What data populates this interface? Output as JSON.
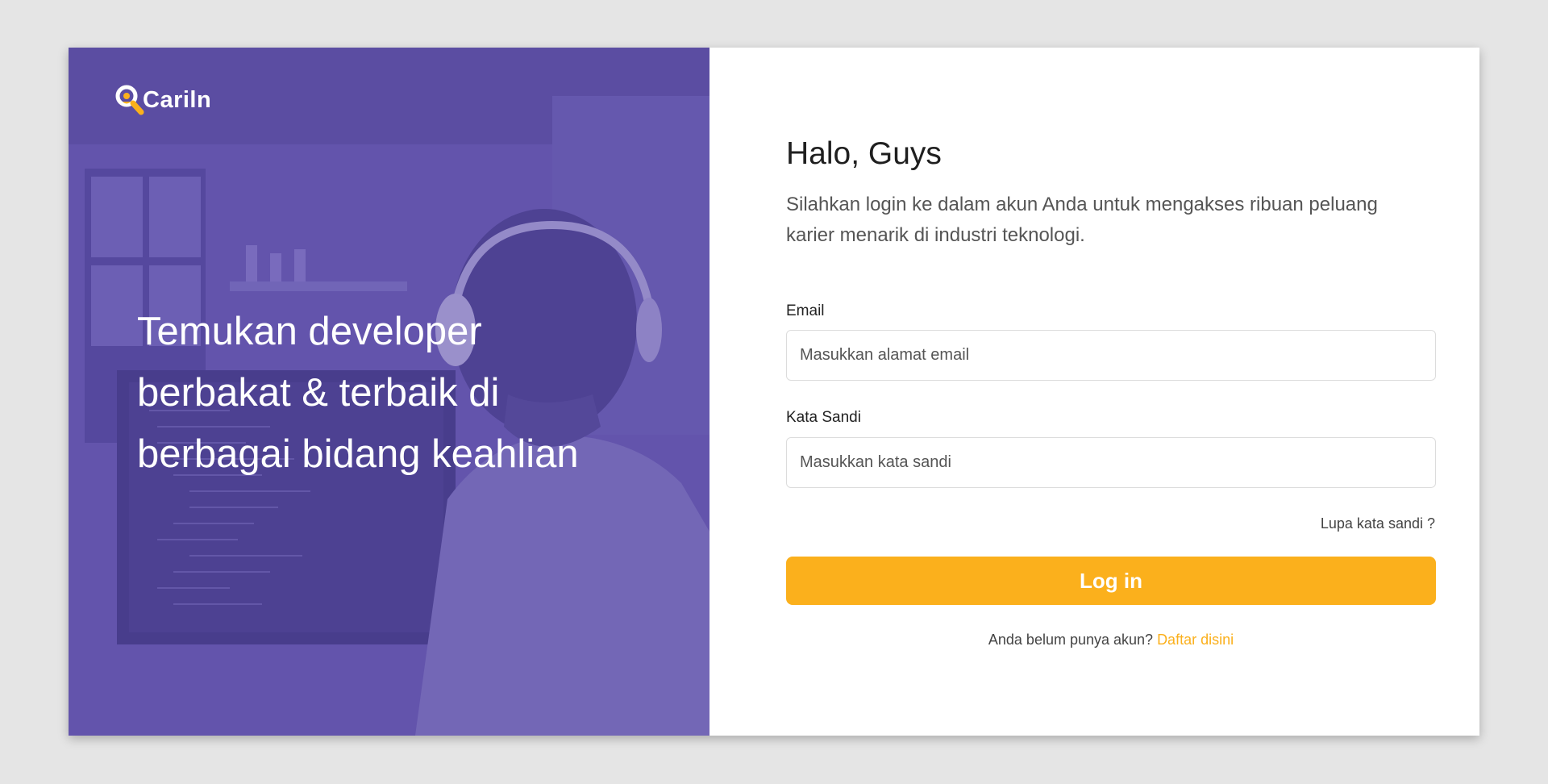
{
  "brand": {
    "name": "Cariln",
    "accent_color": "#fbb01c",
    "hero_color": "#5d4f9f"
  },
  "hero": {
    "title": "Temukan developer berbakat & terbaik di berbagai bidang keahlian",
    "background_icon": "developer-with-headphones-photo"
  },
  "login": {
    "greeting": "Halo, Guys",
    "subtitle": "Silahkan login ke dalam akun Anda untuk mengakses ribuan peluang karier menarik di industri teknologi.",
    "email_label": "Email",
    "email_placeholder": "Masukkan alamat email",
    "email_value": "",
    "password_label": "Kata Sandi",
    "password_placeholder": "Masukkan kata sandi",
    "password_value": "",
    "forgot_label": "Lupa kata sandi ?",
    "submit_label": "Log in",
    "signup_prompt": "Anda belum punya akun?",
    "signup_link": "Daftar disini"
  }
}
